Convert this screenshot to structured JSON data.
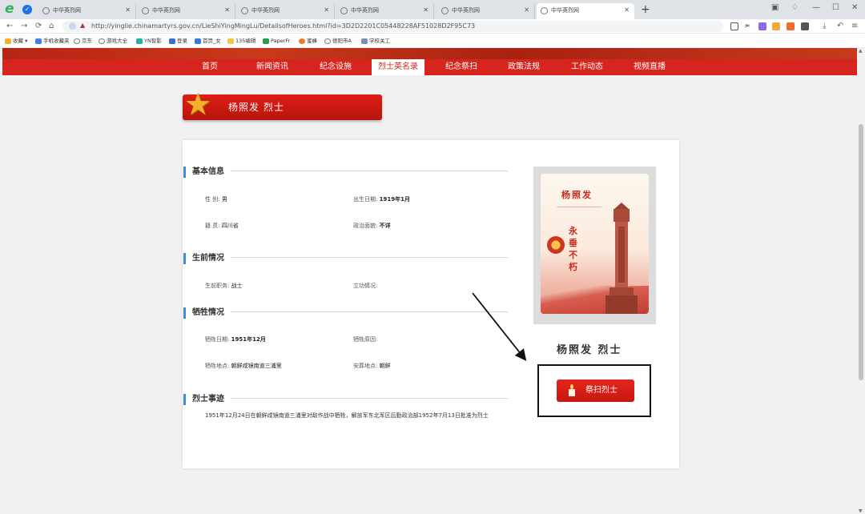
{
  "browser": {
    "tabs": [
      {
        "title": "中华英烈网",
        "active": false
      },
      {
        "title": "中华英烈网",
        "active": false
      },
      {
        "title": "中华英烈网",
        "active": false
      },
      {
        "title": "中华英烈网",
        "active": false
      },
      {
        "title": "中华英烈网",
        "active": false
      },
      {
        "title": "中华英烈网",
        "active": true
      }
    ],
    "url": "http://yinglie.chinamartyrs.gov.cn/LieShiYingMingLu/DetailsofHeroes.html?id=3D2D2201C05448228AF51028D2F95C73",
    "bookmarks": [
      "收藏",
      "手机收藏夹",
      "京东",
      "游戏大全",
      "YN智影",
      "登录",
      "首页_女",
      "135编辑",
      "PaperFr",
      "蜜蜂",
      "德阳市A",
      "学校关工"
    ]
  },
  "nav": {
    "items": [
      "首页",
      "新闻资讯",
      "纪念设施",
      "烈士英名录",
      "纪念祭扫",
      "政策法规",
      "工作动态",
      "视频直播"
    ],
    "active_index": 3
  },
  "title": "杨照发  烈士",
  "sections": {
    "basic": {
      "heading": "基本信息",
      "gender_label": "性    别: ",
      "gender": "男",
      "birth_label": "出生日期: ",
      "birth": "1919年1月",
      "origin_label": "籍    贯: ",
      "origin": "四川省",
      "politics_label": "政治面貌: ",
      "politics": "不详"
    },
    "life": {
      "heading": "生前情况",
      "duty_label": "生前职务: ",
      "duty": "战士",
      "merit_label": "立功情况: ",
      "merit": ""
    },
    "sacrifice": {
      "heading": "牺牲情况",
      "date_label": "牺牲日期: ",
      "date": "1951年12月",
      "reason_label": "牺牲原因: ",
      "reason": "",
      "place_label": "牺牲地点: ",
      "place": "朝鲜咸镜南道三浦里",
      "burial_label": "安葬地点: ",
      "burial": "朝鲜"
    },
    "deeds": {
      "heading": "烈士事迹",
      "text": "1951年12月24日在朝鲜咸镜南道三浦里对敌作战中牺牲，解放军东北军区后勤政治部1952年7月13日批准为烈士"
    }
  },
  "poster": {
    "name": "杨照发",
    "slogan": "永垂不朽"
  },
  "side_name": "杨照发  烈士",
  "tribute_button": "祭扫烈士",
  "colors": {
    "brand_red": "#d5251c",
    "section_accent": "#3b8ee3",
    "star_gold": "#f3b12a"
  }
}
